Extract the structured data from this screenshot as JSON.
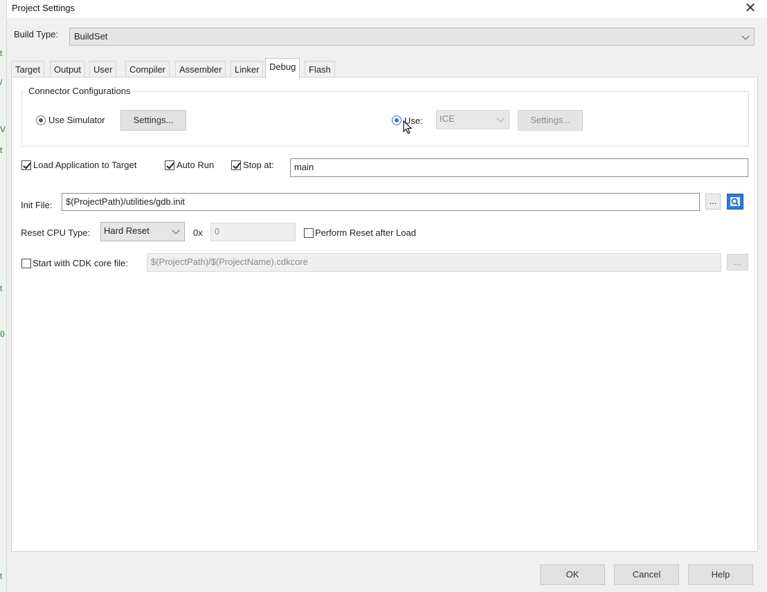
{
  "window": {
    "title": "Project Settings",
    "close_glyph": "✕"
  },
  "build_type": {
    "label": "Build Type:",
    "value": "BuildSet"
  },
  "tabs": [
    {
      "label": "Target"
    },
    {
      "label": "Output"
    },
    {
      "label": "User"
    },
    {
      "label": "Compiler"
    },
    {
      "label": "Assembler"
    },
    {
      "label": "Linker"
    },
    {
      "label": "Debug",
      "active": true
    },
    {
      "label": "Flash"
    }
  ],
  "connector": {
    "legend": "Connector Configurations",
    "use_simulator_label": "Use Simulator",
    "simulator_settings_label": "Settings...",
    "use_label": "Use:",
    "use_value": "ICE",
    "use_settings_label": "Settings...",
    "selected": "use"
  },
  "load": {
    "load_app_label": "Load Application to Target",
    "load_app_checked": true,
    "auto_run_label": "Auto Run",
    "auto_run_checked": true,
    "stop_at_label": "Stop at:",
    "stop_at_checked": true,
    "stop_at_value": "main"
  },
  "init_file": {
    "label": "Init File:",
    "value": "$(ProjectPath)/utilities/gdb.init",
    "browse_label": "..."
  },
  "reset": {
    "label": "Reset CPU Type:",
    "value": "Hard Reset",
    "hex_prefix": "0x",
    "address_value": "0",
    "perform_reset_label": "Perform Reset after Load",
    "perform_reset_checked": false
  },
  "core_file": {
    "label": "Start with CDK core file:",
    "checked": false,
    "value": "$(ProjectPath)/$(ProjectName).cdkcore",
    "browse_label": "..."
  },
  "footer": {
    "ok_label": "OK",
    "cancel_label": "Cancel",
    "help_label": "Help"
  },
  "background_glyphs": [
    "t",
    "/",
    "V",
    "t",
    "t",
    "0",
    "t"
  ],
  "colors": {
    "accent": "#2b79d8",
    "window_bg": "#f0f0f0",
    "panel_bg": "#ffffff"
  }
}
